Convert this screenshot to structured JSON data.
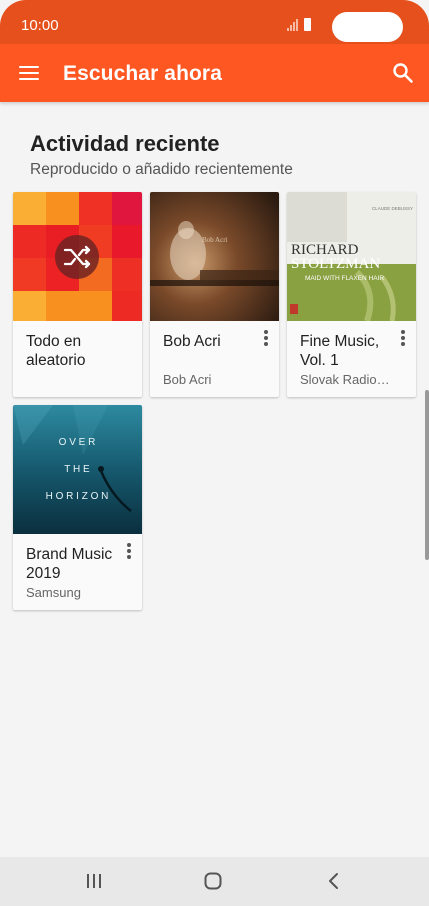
{
  "status_bar": {
    "time": "10:00"
  },
  "app_bar": {
    "title": "Escuchar ahora",
    "color": "#ff5722"
  },
  "section": {
    "title": "Actividad reciente",
    "subtitle": "Reproducido o añadido recientemente"
  },
  "cards": [
    {
      "title": "Todo en aleatorio",
      "subtitle": "",
      "has_menu": false,
      "icon": "shuffle-icon"
    },
    {
      "title": "Bob Acri",
      "subtitle": "Bob Acri",
      "has_menu": true,
      "art_text": "Bob Acri"
    },
    {
      "title": "Fine Music, Vol. 1",
      "subtitle": "Slovak Radio…",
      "has_menu": true,
      "art_header": "CLAUDE DEBUSSY",
      "art_title_1": "RICHARD",
      "art_title_2": "STOLTZMAN",
      "art_subtitle": "MAID WITH FLAXEN HAIR"
    },
    {
      "title": "Brand Music 2019",
      "subtitle": "Samsung",
      "has_menu": true,
      "art_line_1": "O V E R",
      "art_line_2": "T H E",
      "art_line_3": "H O R I Z O N"
    }
  ],
  "nav_bar": {
    "icons": [
      "recent-apps-icon",
      "home-icon",
      "back-icon"
    ]
  }
}
